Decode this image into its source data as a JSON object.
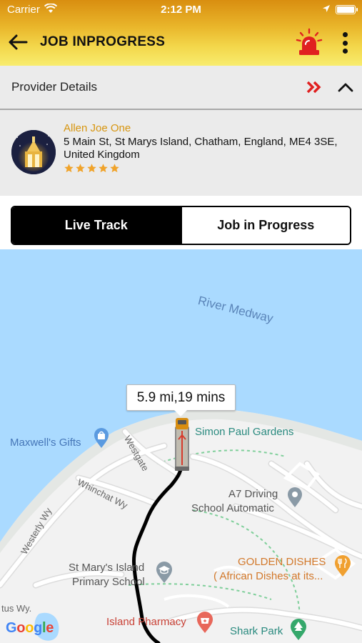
{
  "status_bar": {
    "carrier": "Carrier",
    "time": "2:12 PM"
  },
  "app_bar": {
    "title": "JOB INPROGRESS"
  },
  "provider_section": {
    "header_label": "Provider Details",
    "name": "Allen Joe One",
    "address": "5 Main St, St Marys Island, Chatham, England, ME4 3SE, United Kingdom",
    "rating": 5,
    "rating_max": 5
  },
  "tabs": {
    "live_track": "Live Track",
    "job_in_progress": "Job in Progress",
    "active": "live_track"
  },
  "map": {
    "callout": "5.9 mi,19 mins",
    "labels": {
      "river": "River Medway",
      "simon_paul": "Simon Paul Gardens",
      "maxwells": "Maxwell's Gifts",
      "westgate": "Westgate",
      "whinchat": "Whinchat Wy",
      "westerly": "Westerly Wy",
      "a7_line1": "A7 Driving",
      "a7_line2": "School Automatic",
      "golden_line1": "GOLDEN DISHES",
      "golden_line2": "( African Dishes at its...",
      "school_line1": "St Mary's Island",
      "school_line2": "Primary School",
      "tus": "tus Wy.",
      "pharmacy": "Island Pharmacy",
      "shark_park": "Shark Park",
      "google": "Google"
    }
  },
  "colors": {
    "header_gradient_top": "#d98e10",
    "header_gradient_bottom": "#f8ec6e",
    "provider_name": "#d7950f",
    "star": "#f0a32a",
    "water": "#aadaff",
    "land": "#f2f2f2",
    "route": "#000000",
    "alert_red": "#e02020"
  },
  "icons": {
    "back": "arrow-left-icon",
    "siren": "siren-icon",
    "more": "more-vertical-icon",
    "forward": "double-chevron-right-icon",
    "collapse": "chevron-up-icon",
    "truck": "truck-icon"
  }
}
